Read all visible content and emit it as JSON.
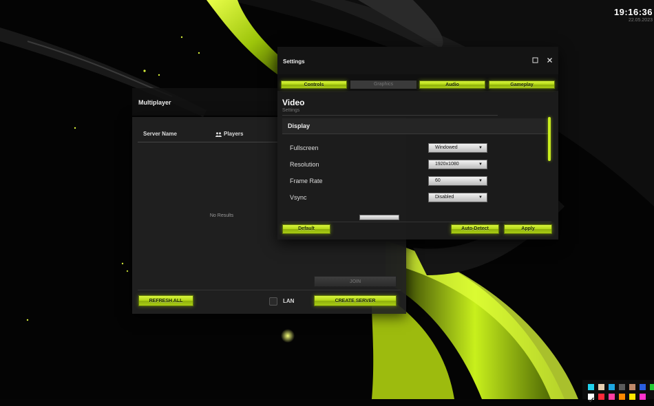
{
  "clock": {
    "time": "19:16:36",
    "date": "22.05.2023"
  },
  "multiplayer": {
    "title": "Multiplayer",
    "columns": {
      "server_name": "Server Name",
      "players": "Players"
    },
    "empty_text": "No Results",
    "join_label": "JOIN",
    "refresh_label": "REFRESH ALL",
    "lan_label": "LAN",
    "create_label": "CREATE SERVER"
  },
  "settings": {
    "title": "Settings",
    "tabs": [
      "Controls",
      "Graphics",
      "Audio",
      "Gameplay"
    ],
    "section_title": "Video",
    "section_sub": "Settings",
    "group_title": "Display",
    "rows": [
      {
        "label": "Fullscreen",
        "value": "Windowed"
      },
      {
        "label": "Resolution",
        "value": "1920x1080"
      },
      {
        "label": "Frame Rate",
        "value": "60"
      },
      {
        "label": "Vsync",
        "value": "Disabled"
      }
    ],
    "default_label": "Default",
    "autodetect_label": "Auto-Detect",
    "apply_label": "Apply"
  },
  "palette_colors": [
    "#22d3ee",
    "#e7cfb0",
    "#1ea7e1",
    "#5c5c5c",
    "#c08a6a",
    "#2b5fe0",
    "#22cc33",
    "#ffffff",
    "#ff2a3a",
    "#ff3fa0",
    "#ff8a00",
    "#ffe600",
    "#ff33cc"
  ]
}
